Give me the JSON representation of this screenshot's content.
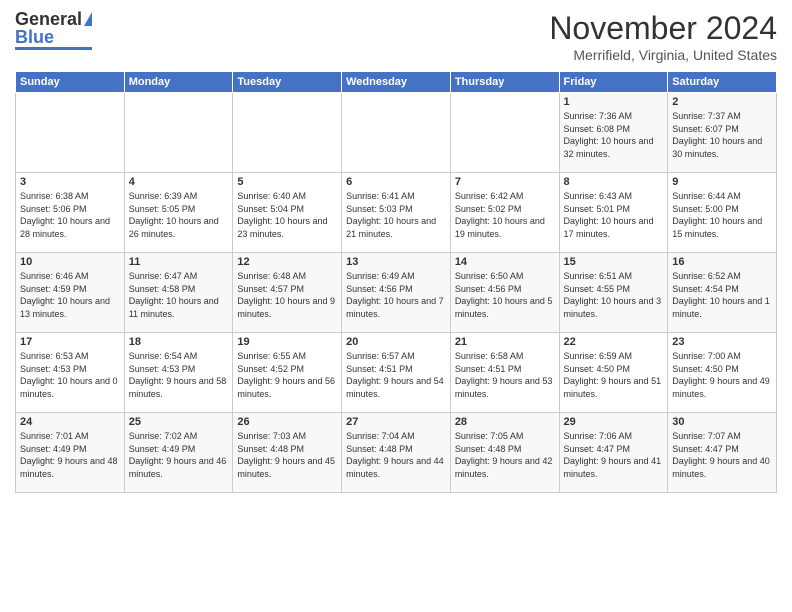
{
  "header": {
    "logo_general": "General",
    "logo_blue": "Blue",
    "month_title": "November 2024",
    "location": "Merrifield, Virginia, United States"
  },
  "days_of_week": [
    "Sunday",
    "Monday",
    "Tuesday",
    "Wednesday",
    "Thursday",
    "Friday",
    "Saturday"
  ],
  "weeks": [
    [
      {
        "day": "",
        "content": ""
      },
      {
        "day": "",
        "content": ""
      },
      {
        "day": "",
        "content": ""
      },
      {
        "day": "",
        "content": ""
      },
      {
        "day": "",
        "content": ""
      },
      {
        "day": "1",
        "content": "Sunrise: 7:36 AM\nSunset: 6:08 PM\nDaylight: 10 hours and 32 minutes."
      },
      {
        "day": "2",
        "content": "Sunrise: 7:37 AM\nSunset: 6:07 PM\nDaylight: 10 hours and 30 minutes."
      }
    ],
    [
      {
        "day": "3",
        "content": "Sunrise: 6:38 AM\nSunset: 5:06 PM\nDaylight: 10 hours and 28 minutes."
      },
      {
        "day": "4",
        "content": "Sunrise: 6:39 AM\nSunset: 5:05 PM\nDaylight: 10 hours and 26 minutes."
      },
      {
        "day": "5",
        "content": "Sunrise: 6:40 AM\nSunset: 5:04 PM\nDaylight: 10 hours and 23 minutes."
      },
      {
        "day": "6",
        "content": "Sunrise: 6:41 AM\nSunset: 5:03 PM\nDaylight: 10 hours and 21 minutes."
      },
      {
        "day": "7",
        "content": "Sunrise: 6:42 AM\nSunset: 5:02 PM\nDaylight: 10 hours and 19 minutes."
      },
      {
        "day": "8",
        "content": "Sunrise: 6:43 AM\nSunset: 5:01 PM\nDaylight: 10 hours and 17 minutes."
      },
      {
        "day": "9",
        "content": "Sunrise: 6:44 AM\nSunset: 5:00 PM\nDaylight: 10 hours and 15 minutes."
      }
    ],
    [
      {
        "day": "10",
        "content": "Sunrise: 6:46 AM\nSunset: 4:59 PM\nDaylight: 10 hours and 13 minutes."
      },
      {
        "day": "11",
        "content": "Sunrise: 6:47 AM\nSunset: 4:58 PM\nDaylight: 10 hours and 11 minutes."
      },
      {
        "day": "12",
        "content": "Sunrise: 6:48 AM\nSunset: 4:57 PM\nDaylight: 10 hours and 9 minutes."
      },
      {
        "day": "13",
        "content": "Sunrise: 6:49 AM\nSunset: 4:56 PM\nDaylight: 10 hours and 7 minutes."
      },
      {
        "day": "14",
        "content": "Sunrise: 6:50 AM\nSunset: 4:56 PM\nDaylight: 10 hours and 5 minutes."
      },
      {
        "day": "15",
        "content": "Sunrise: 6:51 AM\nSunset: 4:55 PM\nDaylight: 10 hours and 3 minutes."
      },
      {
        "day": "16",
        "content": "Sunrise: 6:52 AM\nSunset: 4:54 PM\nDaylight: 10 hours and 1 minute."
      }
    ],
    [
      {
        "day": "17",
        "content": "Sunrise: 6:53 AM\nSunset: 4:53 PM\nDaylight: 10 hours and 0 minutes."
      },
      {
        "day": "18",
        "content": "Sunrise: 6:54 AM\nSunset: 4:53 PM\nDaylight: 9 hours and 58 minutes."
      },
      {
        "day": "19",
        "content": "Sunrise: 6:55 AM\nSunset: 4:52 PM\nDaylight: 9 hours and 56 minutes."
      },
      {
        "day": "20",
        "content": "Sunrise: 6:57 AM\nSunset: 4:51 PM\nDaylight: 9 hours and 54 minutes."
      },
      {
        "day": "21",
        "content": "Sunrise: 6:58 AM\nSunset: 4:51 PM\nDaylight: 9 hours and 53 minutes."
      },
      {
        "day": "22",
        "content": "Sunrise: 6:59 AM\nSunset: 4:50 PM\nDaylight: 9 hours and 51 minutes."
      },
      {
        "day": "23",
        "content": "Sunrise: 7:00 AM\nSunset: 4:50 PM\nDaylight: 9 hours and 49 minutes."
      }
    ],
    [
      {
        "day": "24",
        "content": "Sunrise: 7:01 AM\nSunset: 4:49 PM\nDaylight: 9 hours and 48 minutes."
      },
      {
        "day": "25",
        "content": "Sunrise: 7:02 AM\nSunset: 4:49 PM\nDaylight: 9 hours and 46 minutes."
      },
      {
        "day": "26",
        "content": "Sunrise: 7:03 AM\nSunset: 4:48 PM\nDaylight: 9 hours and 45 minutes."
      },
      {
        "day": "27",
        "content": "Sunrise: 7:04 AM\nSunset: 4:48 PM\nDaylight: 9 hours and 44 minutes."
      },
      {
        "day": "28",
        "content": "Sunrise: 7:05 AM\nSunset: 4:48 PM\nDaylight: 9 hours and 42 minutes."
      },
      {
        "day": "29",
        "content": "Sunrise: 7:06 AM\nSunset: 4:47 PM\nDaylight: 9 hours and 41 minutes."
      },
      {
        "day": "30",
        "content": "Sunrise: 7:07 AM\nSunset: 4:47 PM\nDaylight: 9 hours and 40 minutes."
      }
    ]
  ]
}
